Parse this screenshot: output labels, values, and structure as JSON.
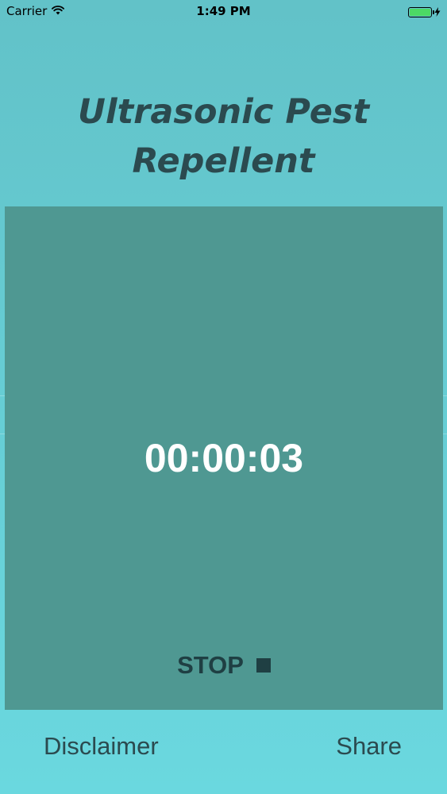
{
  "status_bar": {
    "carrier": "Carrier",
    "time": "1:49 PM",
    "battery_color": "#4cd964"
  },
  "app": {
    "title": "Ultrasonic Pest Repellent"
  },
  "timer": {
    "value": "00:00:03"
  },
  "controls": {
    "stop_label": "STOP"
  },
  "bottom": {
    "disclaimer_label": "Disclaimer",
    "share_label": "Share"
  },
  "colors": {
    "panel": "#4f9892",
    "text_dark": "#2b4a4f"
  }
}
